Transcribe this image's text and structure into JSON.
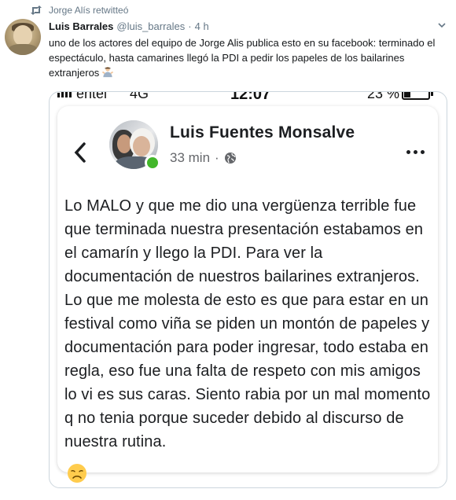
{
  "retweet": {
    "label": "Jorge Alís retwitteó",
    "icon": "retweet-icon"
  },
  "tweet": {
    "display_name": "Luis Barrales",
    "handle": "@luis_barrales",
    "separator": "·",
    "time": "4 h",
    "text": "uno de los actores del equipo de Jorge Alis publica esto en su facebook: terminado el espectáculo, hasta camarines llegó la PDI a pedir los papeles de los bailarines extranjeros",
    "trailing_emoji": "man-shrugging-emoji"
  },
  "screenshot": {
    "status_bar": {
      "carrier": "entel",
      "network": "4G",
      "time": "12:07",
      "battery": "23 %",
      "battery_level": 0.23
    },
    "post": {
      "author": "Luis Fuentes Monsalve",
      "age": "33 min",
      "separator": "·",
      "privacy_icon": "globe-icon",
      "body": "Lo MALO y que me dio una vergüenza terrible fue que terminada nuestra presentación estabamos en el camarín y llego la PDI. Para ver la documentación de nuestros bailarines extranjeros. Lo que me molesta de esto es que para estar en un festival como viña se piden un montón de papeles y documentación para poder ingresar, todo estaba en regla, eso fue una falta de respeto con mis amigos lo vi es sus caras. Siento rabia por un mal momento q no tenia porque suceder debido al discurso de nuestra rutina.",
      "emoji": "disappointed-face-emoji"
    }
  },
  "colors": {
    "muted": "#657786",
    "fb_text": "#1c1e21",
    "online": "#42b72a",
    "border": "#ccd6dd"
  }
}
